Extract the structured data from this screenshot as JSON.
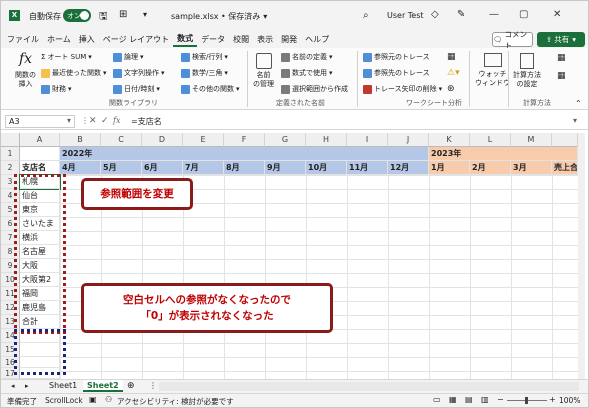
{
  "titlebar": {
    "autosave_label": "自動保存",
    "autosave_state": "オン",
    "filename": "sample.xlsx • 保存済み",
    "user": "User Test"
  },
  "tabs": [
    "ファイル",
    "ホーム",
    "挿入",
    "ページ レイアウト",
    "数式",
    "データ",
    "校閲",
    "表示",
    "開発",
    "ヘルプ"
  ],
  "active_tab": "数式",
  "comment_btn": "コメント",
  "share_btn": "共有",
  "ribbon": {
    "insert_function": "関数の\n挿入",
    "autosum": "オート SUM",
    "recent": "最近使った関数",
    "financial": "財務",
    "logical": "論理",
    "text": "文字列操作",
    "datetime": "日付/時刻",
    "lookup": "検索/行列",
    "math": "数学/三角",
    "more": "その他の関数",
    "group_library": "関数ライブラリ",
    "name_manager": "名前\nの管理",
    "define_name": "名前の定義",
    "use_in_formula": "数式で使用",
    "create_from_sel": "選択範囲から作成",
    "group_names": "定義された名前",
    "trace_prec": "参照元のトレース",
    "trace_dep": "参照先のトレース",
    "remove_arrows": "トレース矢印の削除",
    "group_audit": "ワークシート分析",
    "watch_window": "ウォッチ\nウィンドウ",
    "calc_options": "計算方法\nの設定",
    "group_calc": "計算方法"
  },
  "formula": {
    "namebox": "A3",
    "fx": "fx",
    "content": "=支店名"
  },
  "columns": [
    "A",
    "B",
    "C",
    "D",
    "E",
    "F",
    "G",
    "H",
    "I",
    "J",
    "K",
    "L",
    "M"
  ],
  "rows": [
    "1",
    "2",
    "3",
    "4",
    "5",
    "6",
    "7",
    "8",
    "9",
    "10",
    "11",
    "12",
    "13",
    "14",
    "15",
    "16",
    "17"
  ],
  "row1": {
    "b": "2022年",
    "k": "2023年"
  },
  "row2": [
    "支店名",
    "4月",
    "5月",
    "6月",
    "7月",
    "8月",
    "9月",
    "10月",
    "11月",
    "12月",
    "1月",
    "2月",
    "3月",
    "売上合"
  ],
  "branches": [
    "札幌",
    "仙台",
    "東京",
    "さいたま",
    "横浜",
    "名古屋",
    "大阪",
    "大阪第2",
    "福岡",
    "鹿児島",
    "合計"
  ],
  "callouts": {
    "top": "参照範囲を変更",
    "bottom_line1": "空白セルへの参照がなくなったので",
    "bottom_line2": "「0」が表示されなくなった"
  },
  "sheets": [
    "Sheet1",
    "Sheet2"
  ],
  "active_sheet": "Sheet2",
  "status": {
    "ready": "準備完了",
    "scroll_lock": "ScrollLock",
    "accessibility": "アクセシビリティ: 検討が必要です",
    "zoom": "100%"
  },
  "colors": {
    "accent": "#1b6f3a",
    "header_blue": "#b4c7e7",
    "header_orange": "#f8cbad",
    "callout_border": "#8b1a1a",
    "callout_text": "#c00000",
    "dotted_red": "#9b1c1c",
    "dotted_blue": "#1a237e"
  }
}
